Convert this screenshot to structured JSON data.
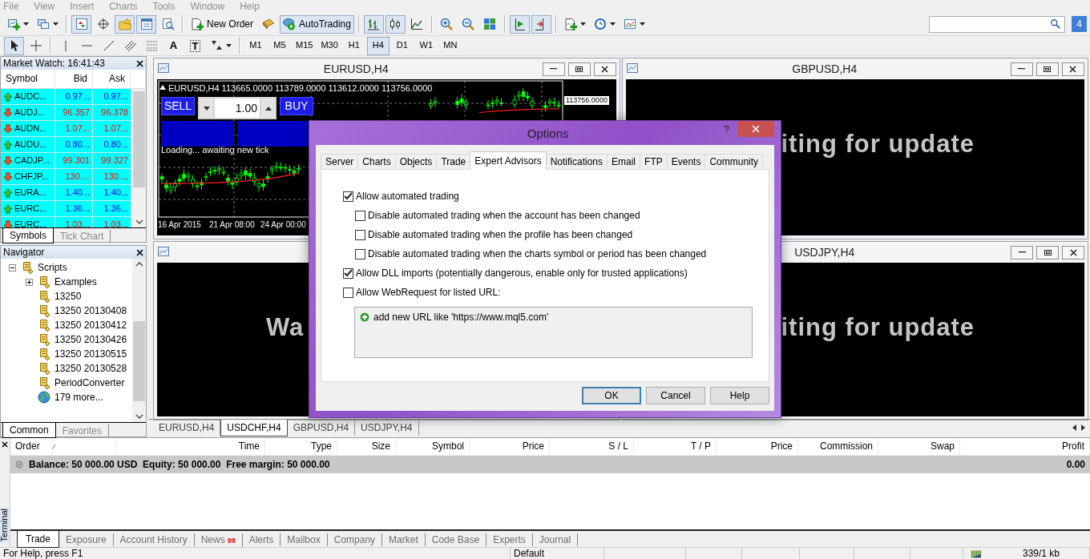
{
  "menu": [
    {
      "label": "File",
      "disabled": true
    },
    {
      "label": "View",
      "disabled": true
    },
    {
      "label": "Insert",
      "disabled": true
    },
    {
      "label": "Charts",
      "disabled": true
    },
    {
      "label": "Tools",
      "disabled": true
    },
    {
      "label": "Window",
      "disabled": true
    },
    {
      "label": "Help",
      "disabled": true
    }
  ],
  "toolbar": [
    {
      "kind": "dropdown",
      "pressed": false
    },
    {
      "kind": "dropdown",
      "pressed": false
    },
    {
      "kind": "separator"
    },
    {
      "kind": "icon",
      "pressed": true
    },
    {
      "kind": "icon",
      "pressed": false
    },
    {
      "kind": "icon",
      "pressed": true
    },
    {
      "kind": "icon",
      "pressed": true
    },
    {
      "kind": "icon",
      "pressed": false
    },
    {
      "kind": "separator"
    },
    {
      "kind": "text",
      "label": "New Order",
      "pressed": false
    },
    {
      "kind": "icon",
      "pressed": false
    },
    {
      "kind": "text",
      "label": "AutoTrading",
      "pressed": true
    },
    {
      "kind": "separator"
    },
    {
      "kind": "icon",
      "pressed": true
    },
    {
      "kind": "icon",
      "pressed": true
    },
    {
      "kind": "icon",
      "pressed": false
    },
    {
      "kind": "separator"
    },
    {
      "kind": "icon",
      "pressed": false
    },
    {
      "kind": "icon",
      "pressed": false
    },
    {
      "kind": "icon",
      "pressed": false
    },
    {
      "kind": "separator"
    },
    {
      "kind": "icon",
      "pressed": true
    },
    {
      "kind": "icon",
      "pressed": true
    },
    {
      "kind": "separator"
    },
    {
      "kind": "dropdown",
      "pressed": false
    },
    {
      "kind": "dropdown",
      "pressed": false
    },
    {
      "kind": "dropdown",
      "pressed": false
    }
  ],
  "search": {
    "messages_count": "4"
  },
  "drawing_toolbar": [
    {
      "kind": "icon",
      "pressed": true
    },
    {
      "kind": "icon",
      "pressed": false
    },
    {
      "kind": "separator"
    },
    {
      "kind": "icon",
      "pressed": false
    },
    {
      "kind": "icon",
      "pressed": false
    },
    {
      "kind": "icon",
      "pressed": false
    },
    {
      "kind": "icon",
      "pressed": false
    },
    {
      "kind": "icon",
      "pressed": false
    },
    {
      "kind": "glyph",
      "label": "A",
      "pressed": false
    },
    {
      "kind": "glyph",
      "label": "T",
      "pressed": false
    },
    {
      "kind": "dropdown",
      "pressed": false
    }
  ],
  "timeframes": [
    {
      "label": "M1",
      "selected": false
    },
    {
      "label": "M5",
      "selected": false
    },
    {
      "label": "M15",
      "selected": false
    },
    {
      "label": "M30",
      "selected": false
    },
    {
      "label": "H1",
      "selected": false
    },
    {
      "label": "H4",
      "selected": true
    },
    {
      "label": "D1",
      "selected": false
    },
    {
      "label": "W1",
      "selected": false
    },
    {
      "label": "MN",
      "selected": false
    }
  ],
  "market_watch": {
    "title": "Market Watch: 16:41:43",
    "columns": [
      "Symbol",
      "Bid",
      "Ask"
    ],
    "rows": [
      {
        "symbol": "AUDC...",
        "bid": "0.97...",
        "ask": "0.97...",
        "rising": true
      },
      {
        "symbol": "AUDJ...",
        "bid": "96.357",
        "ask": "96.378",
        "rising": false
      },
      {
        "symbol": "AUDN...",
        "bid": "1.07...",
        "ask": "1.07...",
        "rising": false
      },
      {
        "symbol": "AUDU...",
        "bid": "0.80...",
        "ask": "0.80...",
        "rising": true
      },
      {
        "symbol": "CADJP...",
        "bid": "99.301",
        "ask": "99.327",
        "rising": false
      },
      {
        "symbol": "CHFJP...",
        "bid": "130....",
        "ask": "130....",
        "rising": false
      },
      {
        "symbol": "EURA...",
        "bid": "1.40...",
        "ask": "1.40...",
        "rising": true
      },
      {
        "symbol": "EURC...",
        "bid": "1.36...",
        "ask": "1.36...",
        "rising": true
      },
      {
        "symbol": "EURC...",
        "bid": "1.03...",
        "ask": "1.03...",
        "rising": false
      }
    ],
    "tabs": [
      {
        "label": "Symbols",
        "selected": true
      },
      {
        "label": "Tick Chart",
        "selected": false
      }
    ]
  },
  "navigator": {
    "title": "Navigator",
    "tree": [
      {
        "label": "Scripts",
        "kind": "folder",
        "expanded": true,
        "children": [
          {
            "label": "Examples",
            "kind": "folder",
            "expanded": false
          },
          {
            "label": "13250",
            "kind": "script"
          },
          {
            "label": "13250 20130408",
            "kind": "script"
          },
          {
            "label": "13250 20130412",
            "kind": "script"
          },
          {
            "label": "13250 20130426",
            "kind": "script"
          },
          {
            "label": "13250 20130515",
            "kind": "script"
          },
          {
            "label": "13250 20130528",
            "kind": "script"
          },
          {
            "label": "PeriodConverter",
            "kind": "script"
          },
          {
            "label": "179 more...",
            "kind": "more"
          }
        ]
      }
    ],
    "tabs": [
      {
        "label": "Common",
        "selected": true
      },
      {
        "label": "Favorites",
        "selected": false
      }
    ]
  },
  "chart_windows": [
    {
      "kind": "chart",
      "title": "EURUSD,H4",
      "header": "EURUSD,H4 113665.0000 113789.0000 113612.0000 113756.0000",
      "sell": "SELL",
      "lot": "1.00",
      "buy": "BUY",
      "status": "Loading... awaiting new tick",
      "dates": [
        "16 Apr 2015",
        "21 Apr 08:00",
        "24 Apr 00:00"
      ],
      "price": "113756.0000"
    },
    {
      "kind": "waiting",
      "title": "GBPUSD,H4",
      "message": "iting for update",
      "leading_hidden": true
    },
    {
      "kind": "waiting",
      "message": "Wa",
      "leading_hidden": false
    },
    {
      "kind": "waiting",
      "title": "USDJPY,H4",
      "message": "iting for update",
      "leading_hidden": true
    }
  ],
  "chart_tabs": [
    {
      "label": "EURUSD,H4",
      "selected": false
    },
    {
      "label": "USDCHF,H4",
      "selected": true
    },
    {
      "label": "GBPUSD,H4",
      "selected": false
    },
    {
      "label": "USDJPY,H4",
      "selected": false
    }
  ],
  "options_dialog": {
    "title": "Options",
    "help": "?",
    "tabs": [
      {
        "label": "Server",
        "selected": false
      },
      {
        "label": "Charts",
        "selected": false
      },
      {
        "label": "Objects",
        "selected": false
      },
      {
        "label": "Trade",
        "selected": false
      },
      {
        "label": "Expert Advisors",
        "selected": true
      },
      {
        "label": "Notifications",
        "selected": false
      },
      {
        "label": "Email",
        "selected": false
      },
      {
        "label": "FTP",
        "selected": false
      },
      {
        "label": "Events",
        "selected": false
      },
      {
        "label": "Community",
        "selected": false
      }
    ],
    "options": [
      {
        "label": "Allow automated trading",
        "checked": true,
        "children": [
          {
            "label": "Disable automated trading when the account has been changed",
            "checked": false
          },
          {
            "label": "Disable automated trading when the profile has been changed",
            "checked": false
          },
          {
            "label": "Disable automated trading when the charts symbol or period has been changed",
            "checked": false
          }
        ]
      },
      {
        "label": "Allow DLL imports (potentially dangerous, enable only for trusted applications)",
        "checked": true
      },
      {
        "label": "Allow WebRequest for listed URL:",
        "checked": false
      }
    ],
    "url_list": {
      "add_item": "add new URL like 'https://www.mql5.com'"
    },
    "buttons": [
      {
        "label": "OK",
        "default": true
      },
      {
        "label": "Cancel",
        "default": false
      },
      {
        "label": "Help",
        "default": false
      }
    ]
  },
  "terminal": {
    "title": "Terminal",
    "columns": [
      "Order",
      "Time",
      "Type",
      "Size",
      "Symbol",
      "Price",
      "S / L",
      "T / P",
      "Price",
      "Commission",
      "Swap",
      "Profit"
    ],
    "balance": "Balance: 50 000.00 USD  Equity: 50 000.00  Free margin: 50 000.00",
    "profit": "0.00",
    "tabs": [
      {
        "label": "Trade",
        "selected": true
      },
      {
        "label": "Exposure",
        "selected": false
      },
      {
        "label": "Account History",
        "selected": false
      },
      {
        "label": "News",
        "badge": "99",
        "selected": false
      },
      {
        "label": "Alerts",
        "selected": false
      },
      {
        "label": "Mailbox",
        "selected": false
      },
      {
        "label": "Company",
        "selected": false
      },
      {
        "label": "Market",
        "selected": false
      },
      {
        "label": "Code Base",
        "selected": false
      },
      {
        "label": "Experts",
        "selected": false
      },
      {
        "label": "Journal",
        "selected": false
      }
    ]
  },
  "status_bar": {
    "help": "For Help, press F1",
    "profile": "Default",
    "traffic": "339/1 kb"
  }
}
